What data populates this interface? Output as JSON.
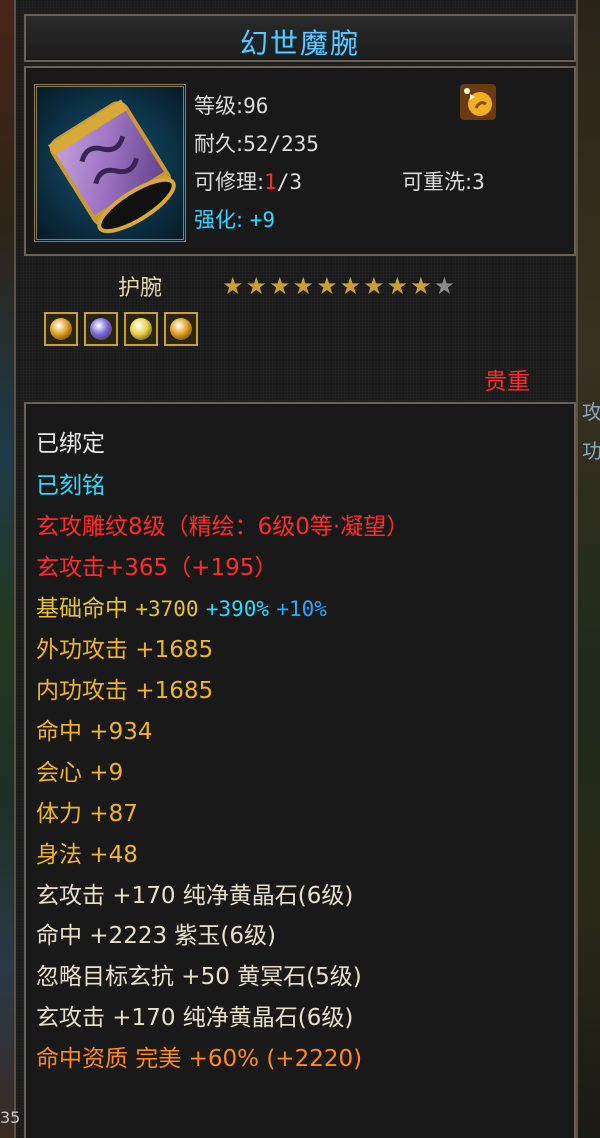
{
  "item": {
    "name": "幻世魔腕",
    "level_label": "等级",
    "level_value": "96",
    "durability_label": "耐久",
    "durability_value": "52/235",
    "repairable_label": "可修理",
    "repairable_current": "1",
    "repairable_max": "/3",
    "rewash_label": "可重洗",
    "rewash_value": "3",
    "enhance_label": "强化:",
    "enhance_value": "+9",
    "type": "护腕",
    "stars_filled": 9,
    "stars_total": 10,
    "rarity": "贵重"
  },
  "gems": [
    {
      "name": "gem-gold-red",
      "color": "#e0a020"
    },
    {
      "name": "gem-purple",
      "color": "#7a6ad8"
    },
    {
      "name": "gem-yellow",
      "color": "#e8d040"
    },
    {
      "name": "gem-gold-red-2",
      "color": "#e0a020"
    }
  ],
  "attributes": {
    "bound": "已绑定",
    "engraved": "已刻铭",
    "carving": "玄攻雕纹8级（精绘：6级0等·凝望）",
    "xuan_attack": "玄攻击+365（+195）",
    "base_hit_label": "基础命中",
    "base_hit_value": "+3700",
    "base_hit_pct1": "+390%",
    "base_hit_pct2": "+10%",
    "stats": [
      "外功攻击 +1685",
      "内功攻击 +1685",
      "命中 +934",
      "会心 +9",
      "体力 +87",
      "身法 +48"
    ],
    "gem_stats": [
      "玄攻击 +170 纯净黄晶石(6级)",
      "命中 +2223 紫玉(6级)",
      "忽略目标玄抗 +50 黄冥石(5级)",
      "玄攻击 +170 纯净黄晶石(6级)"
    ],
    "aptitude": "命中资质  完美 +60% (+2220)"
  },
  "edge_text": {
    "right_top": "攻",
    "right_mid": "功",
    "left_bottom": "35"
  }
}
